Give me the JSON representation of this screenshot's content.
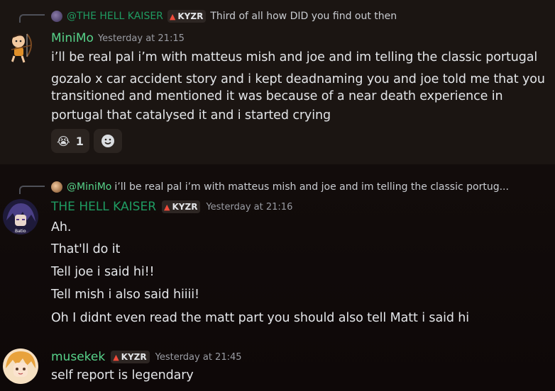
{
  "messages": [
    {
      "reply": {
        "author": "@THE HELL KAISER",
        "tag": "KYZR",
        "text": "Third of all how DID you find out then"
      },
      "author": "MiniMo",
      "author_color": "#57d38a",
      "timestamp": "Yesterday at 21:15",
      "lines": [
        "i’ll be real pal i’m with matteus mish and joe and im telling the classic portugal",
        "gozalo x car accident story and i kept deadnaming you and joe told me that you",
        "transitioned and mentioned it was because of a near death experience in",
        "portugal that catalysed it and i started crying"
      ],
      "reactions": [
        {
          "emoji": "😭",
          "count": "1"
        }
      ],
      "add_reaction_icon": "smiley-add-icon"
    },
    {
      "reply": {
        "author": "@MiniMo",
        "text": "i’ll be real pal i’m with matteus mish and joe and im telling the classic portug..."
      },
      "author": "THE HELL KAISER",
      "author_color": "#1f9c62",
      "tag": "KYZR",
      "timestamp": "Yesterday at 21:16",
      "lines": [
        "Ah.",
        "That'll do it",
        "Tell joe i said hi!!",
        "Tell mish i also said hiiii!",
        "Oh I didnt even read the matt part you should also tell Matt i said hi"
      ]
    },
    {
      "author": "musekek",
      "author_color": "#57d38a",
      "tag": "KYZR",
      "timestamp": "Yesterday at 21:45",
      "lines": [
        "self report is legendary"
      ]
    }
  ]
}
